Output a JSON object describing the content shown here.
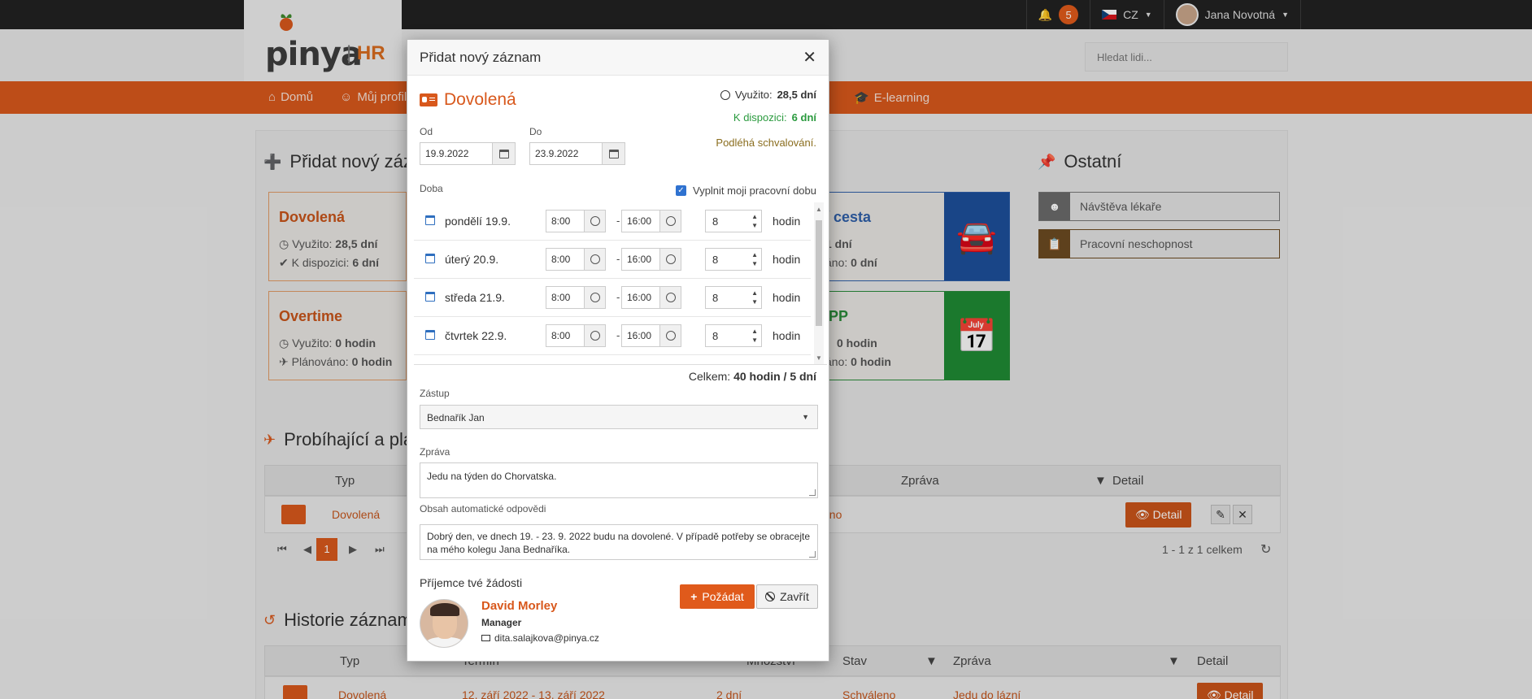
{
  "topbar": {
    "notification_count": "5",
    "language": "CZ",
    "user_name": "Jana Novotná"
  },
  "logo": {
    "brand": "pinya",
    "suffix": "HR"
  },
  "search": {
    "placeholder": "Hledat lidi..."
  },
  "nav": {
    "home": "Domů",
    "profile": "Můj profil",
    "elearning": "E-learning"
  },
  "background": {
    "add_record_title": "Přidat nový zázn",
    "other_title": "Ostatní",
    "other_items": [
      "Návštěva lékaře",
      "Pracovní neschopnost"
    ],
    "cards": {
      "vacation": {
        "title": "Dovolená",
        "used_label": "Využito:",
        "used_value": "28,5 dní",
        "avail_label": "K dispozici:",
        "avail_value": "6 dní"
      },
      "overtime": {
        "title": "Overtime",
        "used_label": "Využito:",
        "used_value": "0 hodin",
        "planned_label": "Plánováno:",
        "planned_value": "0 hodin"
      },
      "trip": {
        "title": "í cesta",
        "line1_label": "",
        "line1_value": "1 dní",
        "line2_label": "áno:",
        "line2_value": "0 dní"
      },
      "pp": {
        "title": "PP",
        "line1_value": "0 hodin",
        "line2_label": "áno:",
        "line2_value": "0 hodin"
      }
    },
    "ongoing_title": "Probíhající a plá",
    "ongoing_table": {
      "headers": {
        "type": "Typ",
        "message": "Zpráva",
        "detail": "Detail"
      },
      "row": {
        "type": "Dovolená",
        "status_fragment": "eno",
        "detail_btn": "Detail"
      },
      "page": "1",
      "summary": "1 - 1 z 1 celkem"
    },
    "history_title": "Historie záznam",
    "history_table": {
      "headers": {
        "type": "Typ",
        "term": "Termín",
        "amount": "Množství",
        "status": "Stav",
        "message": "Zpráva",
        "detail": "Detail"
      },
      "row": {
        "type": "Dovolená",
        "term": "12. září 2022 - 13. září 2022",
        "amount": "2 dní",
        "status": "Schváleno",
        "message": "Jedu do lázní",
        "detail_btn": "Detail"
      }
    }
  },
  "modal": {
    "title": "Přidat nový záznam",
    "type_name": "Dovolená",
    "stats": {
      "used_label": "Využito:",
      "used_value": "28,5 dní",
      "avail_label": "K dispozici:",
      "avail_value": "6 dní",
      "approval_note": "Podléhá schvalování."
    },
    "from_label": "Od",
    "from_value": "19.9.2022",
    "to_label": "Do",
    "to_value": "23.9.2022",
    "duration_label": "Doba",
    "fill_workhours_label": "Vyplnit moji pracovní dobu",
    "fill_workhours_checked": true,
    "days": [
      {
        "name": "pondělí 19.9.",
        "from": "8:00",
        "to": "16:00",
        "hours": "8",
        "unit": "hodin"
      },
      {
        "name": "úterý 20.9.",
        "from": "8:00",
        "to": "16:00",
        "hours": "8",
        "unit": "hodin"
      },
      {
        "name": "středa 21.9.",
        "from": "8:00",
        "to": "16:00",
        "hours": "8",
        "unit": "hodin"
      },
      {
        "name": "čtvrtek 22.9.",
        "from": "8:00",
        "to": "16:00",
        "hours": "8",
        "unit": "hodin"
      }
    ],
    "total_label": "Celkem:",
    "total_value": "40 hodin / 5 dní",
    "substitute_label": "Zástup",
    "substitute_value": "Bednařík Jan",
    "message_label": "Zpráva",
    "message_value": "Jedu na týden do Chorvatska.",
    "autoreply_label": "Obsah automatické odpovědi",
    "autoreply_value": "Dobrý den, ve dnech 19. - 23. 9. 2022 budu na dovolené. V případě potřeby se obracejte na mého kolegu Jana Bednaříka.",
    "recipients_label": "Příjemce tvé žádosti",
    "request_btn": "Požádat",
    "close_btn": "Zavřít",
    "approver": {
      "name": "David Morley",
      "role": "Manager",
      "email": "dita.salajkova@pinya.cz"
    }
  },
  "colors": {
    "accent": "#d8581c",
    "success": "#2a9a3e",
    "primary": "#2f72d0"
  }
}
